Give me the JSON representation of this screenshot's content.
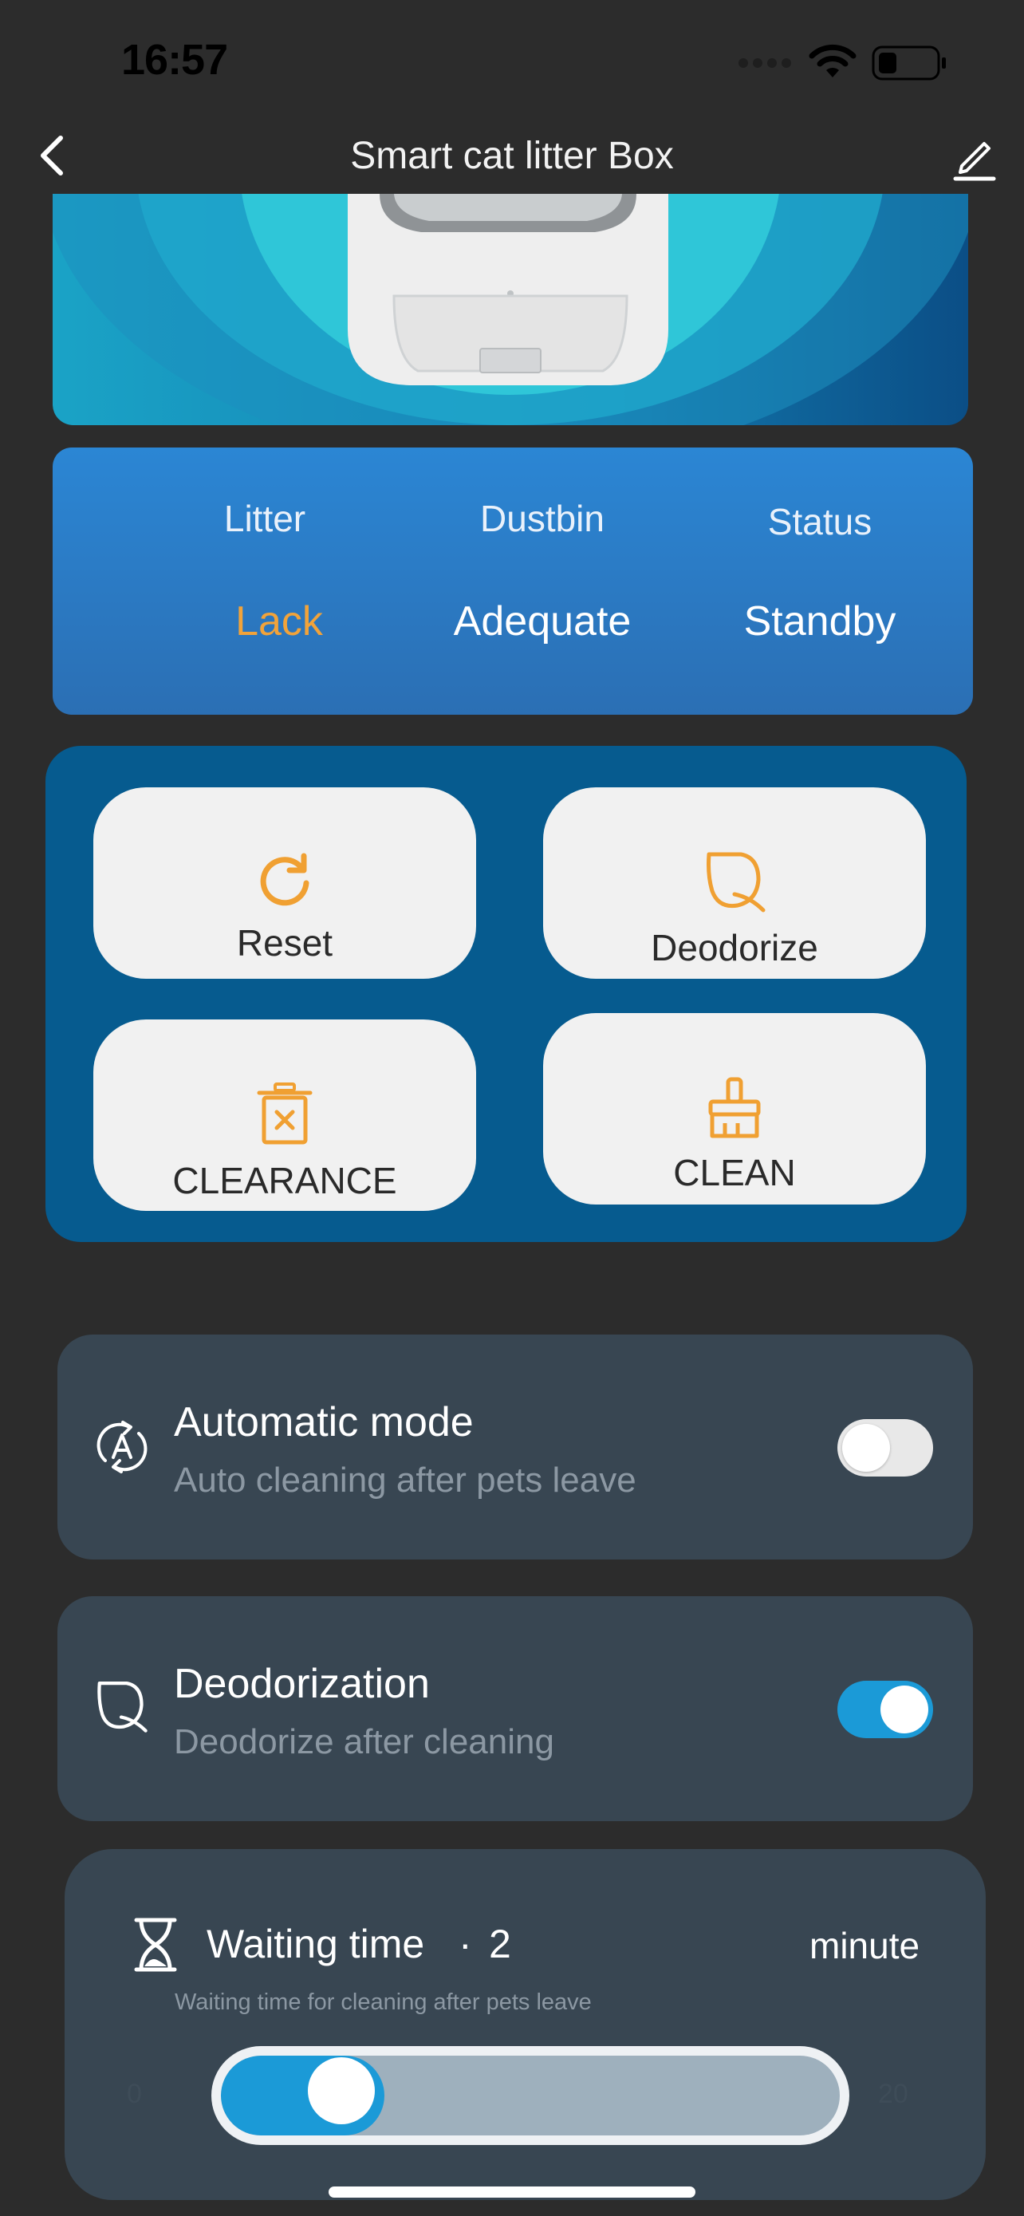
{
  "status_bar": {
    "time": "16:57"
  },
  "nav": {
    "title": "Smart cat litter Box"
  },
  "status_panel": {
    "items": [
      {
        "label": "Litter",
        "value": "Lack",
        "value_color": "#f1a33a"
      },
      {
        "label": "Dustbin",
        "value": "Adequate",
        "value_color": "#ffffff"
      },
      {
        "label": "Status",
        "value": "Standby",
        "value_color": "#ffffff"
      }
    ]
  },
  "actions": {
    "reset": {
      "label": "Reset",
      "icon": "refresh-icon"
    },
    "deodorize": {
      "label": "Deodorize",
      "icon": "leaf-icon"
    },
    "clearance": {
      "label": "CLEARANCE",
      "icon": "trash-x-icon"
    },
    "clean": {
      "label": "CLEAN",
      "icon": "broom-icon"
    },
    "accent_color": "#f0a032"
  },
  "settings": {
    "automatic_mode": {
      "title": "Automatic mode",
      "subtitle": "Auto cleaning after pets leave",
      "enabled": false,
      "icon": "auto-mode-icon"
    },
    "deodorization": {
      "title": "Deodorization",
      "subtitle": "Deodorize after cleaning",
      "enabled": true,
      "icon": "leaf-icon"
    }
  },
  "waiting_time": {
    "title": "Waiting time",
    "separator": "·",
    "value": "2",
    "unit": "minute",
    "subtitle": "Waiting time for cleaning after pets leave",
    "min": "0",
    "max": "20",
    "current": 2,
    "icon": "hourglass-icon"
  },
  "colors": {
    "toggle_on": "#1b9ad7",
    "card_bg": "#384652",
    "action_panel_bg": "#065b8f"
  }
}
